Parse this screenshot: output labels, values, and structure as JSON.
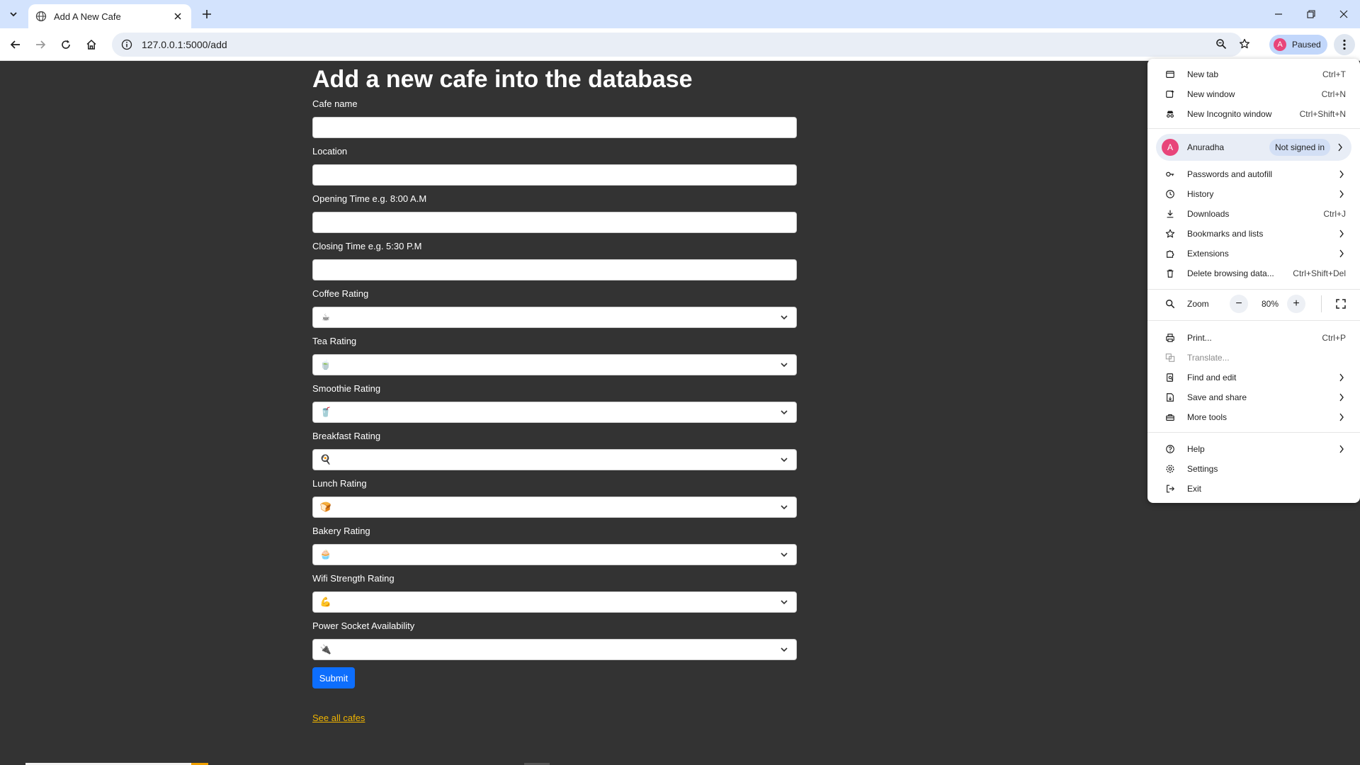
{
  "browser": {
    "tab_title": "Add A New Cafe",
    "url": "127.0.0.1:5000/add",
    "profile_status": "Paused",
    "profile_initial": "A"
  },
  "page": {
    "title": "Add a new cafe into the database",
    "fields": [
      {
        "label": "Cafe name",
        "type": "text",
        "value": ""
      },
      {
        "label": "Location",
        "type": "text",
        "value": ""
      },
      {
        "label": "Opening Time e.g. 8:00 A.M",
        "type": "text",
        "value": ""
      },
      {
        "label": "Closing Time e.g. 5:30 P.M",
        "type": "text",
        "value": ""
      },
      {
        "label": "Coffee Rating",
        "type": "select",
        "value": "☕",
        "icon": "coffee-cup-icon"
      },
      {
        "label": "Tea Rating",
        "type": "select",
        "value": "🍵",
        "icon": "tea-icon"
      },
      {
        "label": "Smoothie Rating",
        "type": "select",
        "value": "🥤",
        "icon": "smoothie-cup-icon"
      },
      {
        "label": "Breakfast Rating",
        "type": "select",
        "value": "🍳",
        "icon": "breakfast-icon"
      },
      {
        "label": "Lunch Rating",
        "type": "select",
        "value": "🍞",
        "icon": "lunch-icon"
      },
      {
        "label": "Bakery Rating",
        "type": "select",
        "value": "🧁",
        "icon": "cupcake-icon"
      },
      {
        "label": "Wifi Strength Rating",
        "type": "select",
        "value": "💪",
        "icon": "flexed-arm-icon"
      },
      {
        "label": "Power Socket Availability",
        "type": "select",
        "value": "🔌",
        "icon": "plug-icon"
      }
    ],
    "submit_label": "Submit",
    "see_all_label": "See all cafes"
  },
  "menu": {
    "items_top": [
      {
        "label": "New tab",
        "shortcut": "Ctrl+T",
        "icon": "new-tab-icon"
      },
      {
        "label": "New window",
        "shortcut": "Ctrl+N",
        "icon": "new-window-icon"
      },
      {
        "label": "New Incognito window",
        "shortcut": "Ctrl+Shift+N",
        "icon": "incognito-icon"
      }
    ],
    "profile": {
      "initial": "A",
      "name": "Anuradha",
      "status": "Not signed in"
    },
    "items_mid": [
      {
        "label": "Passwords and autofill",
        "shortcut": "",
        "icon": "key-icon",
        "submenu": true
      },
      {
        "label": "History",
        "shortcut": "",
        "icon": "history-icon",
        "submenu": true
      },
      {
        "label": "Downloads",
        "shortcut": "Ctrl+J",
        "icon": "download-icon",
        "submenu": false
      },
      {
        "label": "Bookmarks and lists",
        "shortcut": "",
        "icon": "star-icon",
        "submenu": true
      },
      {
        "label": "Extensions",
        "shortcut": "",
        "icon": "puzzle-icon",
        "submenu": true
      },
      {
        "label": "Delete browsing data...",
        "shortcut": "Ctrl+Shift+Del",
        "icon": "trash-icon",
        "submenu": false
      }
    ],
    "zoom": {
      "label": "Zoom",
      "value": "80%",
      "minus": "−",
      "plus": "+"
    },
    "items_tools": [
      {
        "label": "Print...",
        "shortcut": "Ctrl+P",
        "icon": "print-icon",
        "submenu": false,
        "disabled": false
      },
      {
        "label": "Translate...",
        "shortcut": "",
        "icon": "translate-icon",
        "submenu": false,
        "disabled": true
      },
      {
        "label": "Find and edit",
        "shortcut": "",
        "icon": "find-icon",
        "submenu": true,
        "disabled": false
      },
      {
        "label": "Save and share",
        "shortcut": "",
        "icon": "save-icon",
        "submenu": true,
        "disabled": false
      },
      {
        "label": "More tools",
        "shortcut": "",
        "icon": "toolbox-icon",
        "submenu": true,
        "disabled": false
      }
    ],
    "items_bottom": [
      {
        "label": "Help",
        "shortcut": "",
        "icon": "help-icon",
        "submenu": true
      },
      {
        "label": "Settings",
        "shortcut": "",
        "icon": "settings-icon",
        "submenu": false
      },
      {
        "label": "Exit",
        "shortcut": "",
        "icon": "exit-icon",
        "submenu": false
      }
    ]
  }
}
